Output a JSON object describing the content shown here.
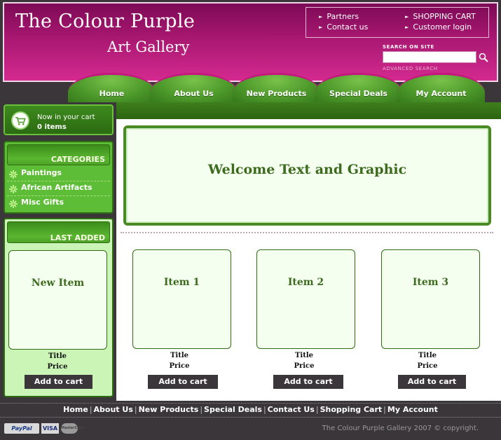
{
  "header": {
    "title": "The Colour Purple",
    "subtitle": "Art Gallery",
    "links": [
      "Partners",
      "Contact us",
      "SHOPPING CART",
      "Customer login"
    ],
    "search_label": "SEARCH ON SITE",
    "search_placeholder": "",
    "advanced_search": "ADVANCED SEARCH"
  },
  "nav": {
    "tabs": [
      "Home",
      "About Us",
      "New Products",
      "Special Deals",
      "My Account"
    ]
  },
  "cart": {
    "line1": "Now in your cart",
    "line2": "0 items"
  },
  "categories": {
    "heading": "CATEGORIES",
    "items": [
      "Paintings",
      "African Artifacts",
      "Misc Gifts"
    ]
  },
  "last_added": {
    "heading": "LAST ADDED",
    "item": {
      "name": "New Item",
      "title": "Title",
      "price": "Price",
      "button": "Add to cart"
    }
  },
  "welcome": {
    "text": "Welcome Text and Graphic"
  },
  "products": [
    {
      "name": "Item 1",
      "title": "Title",
      "price": "Price",
      "button": "Add to cart"
    },
    {
      "name": "Item 2",
      "title": "Title",
      "price": "Price",
      "button": "Add to cart"
    },
    {
      "name": "Item 3",
      "title": "Title",
      "price": "Price",
      "button": "Add to cart"
    }
  ],
  "footer": {
    "links": [
      "Home",
      "About Us",
      "New Products",
      "Special Deals",
      "Contact Us",
      "Shopping Cart",
      "My Account"
    ],
    "payment": [
      "PayPal",
      "VISA",
      "MasterCard"
    ],
    "copyright": "The Colour Purple Gallery 2007 © copyright."
  },
  "colors": {
    "brand_pink": "#d42a90",
    "brand_green": "#4e9a2b",
    "dark": "#3a3639"
  }
}
